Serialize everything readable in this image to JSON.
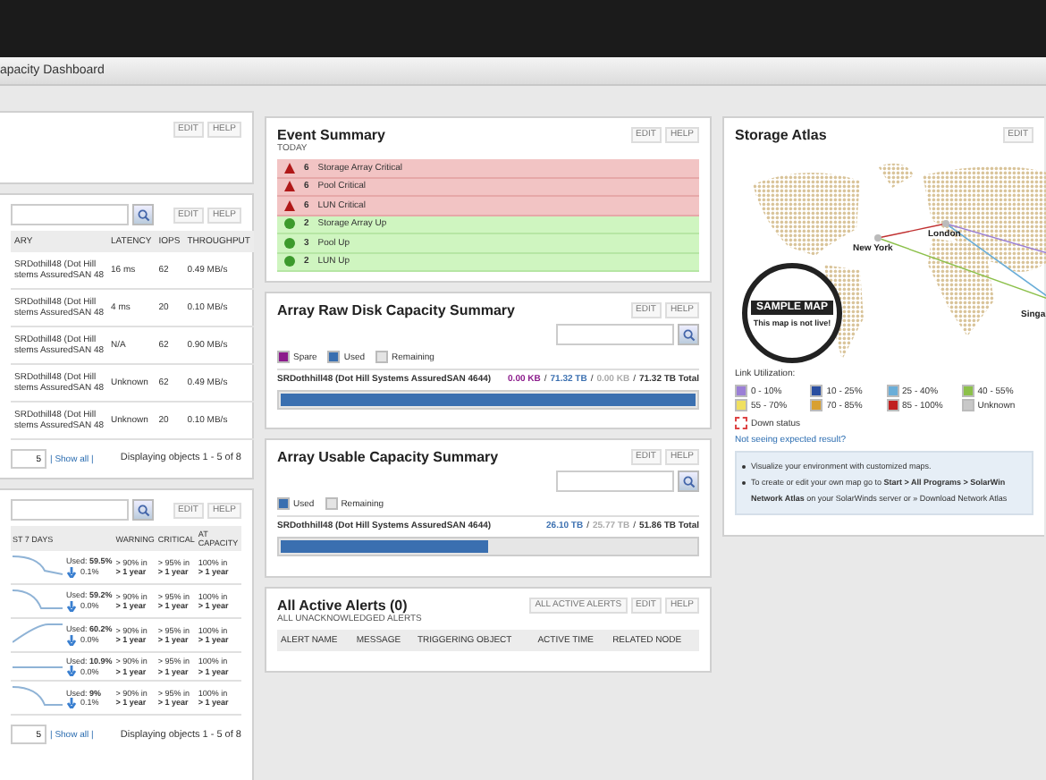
{
  "window": {
    "title": "apacity Dashboard"
  },
  "left_top_panel": {
    "buttons": [
      "EDIT",
      "HELP"
    ]
  },
  "performance_panel": {
    "buttons": [
      "EDIT",
      "HELP"
    ],
    "columns": [
      "ARY",
      "LATENCY",
      "IOPS",
      "THROUGHPUT"
    ],
    "rows": [
      {
        "name_lines": [
          "SRDothill48 (Dot Hill",
          "stems AssuredSAN 48"
        ],
        "latency": "16 ms",
        "iops": "62",
        "throughput": "0.49 MB/s"
      },
      {
        "name_lines": [
          "SRDothill48 (Dot Hill",
          "stems AssuredSAN 48"
        ],
        "latency": "4 ms",
        "iops": "20",
        "throughput": "0.10 MB/s"
      },
      {
        "name_lines": [
          "SRDothill48 (Dot Hill",
          "stems AssuredSAN 48"
        ],
        "latency": "N/A",
        "iops": "62",
        "throughput": "0.90 MB/s"
      },
      {
        "name_lines": [
          "SRDothill48 (Dot Hill",
          "stems AssuredSAN 48"
        ],
        "latency": "Unknown",
        "iops": "62",
        "throughput": "0.49 MB/s"
      },
      {
        "name_lines": [
          "SRDothill48 (Dot Hill",
          "stems AssuredSAN 48"
        ],
        "latency": "Unknown",
        "iops": "20",
        "throughput": "0.10 MB/s"
      }
    ],
    "page_size": "5",
    "show_all": "| Show all |",
    "paging": "Displaying objects 1 - 5 of 8"
  },
  "forecast_panel": {
    "buttons": [
      "EDIT",
      "HELP"
    ],
    "columns": [
      "ST 7 DAYS",
      "WARNING",
      "CRITICAL",
      "AT CAPACITY"
    ],
    "rows": [
      {
        "used_label": "Used:",
        "used": "59.5%",
        "change": "0.1%",
        "warning": [
          "> 90% in",
          "> 1 year"
        ],
        "critical": [
          "> 95% in",
          "> 1 year"
        ],
        "capacity": [
          "100% in",
          "> 1 year"
        ]
      },
      {
        "used_label": "Used:",
        "used": "59.2%",
        "change": "0.0%",
        "warning": [
          "> 90% in",
          "> 1 year"
        ],
        "critical": [
          "> 95% in",
          "> 1 year"
        ],
        "capacity": [
          "100% in",
          "> 1 year"
        ]
      },
      {
        "used_label": "Used:",
        "used": "60.2%",
        "change": "0.0%",
        "warning": [
          "> 90% in",
          "> 1 year"
        ],
        "critical": [
          "> 95% in",
          "> 1 year"
        ],
        "capacity": [
          "100% in",
          "> 1 year"
        ]
      },
      {
        "used_label": "Used:",
        "used": "10.9%",
        "change": "0.0%",
        "warning": [
          "> 90% in",
          "> 1 year"
        ],
        "critical": [
          "> 95% in",
          "> 1 year"
        ],
        "capacity": [
          "100% in",
          "> 1 year"
        ]
      },
      {
        "used_label": "Used:",
        "used": "9%",
        "change": "0.1%",
        "warning": [
          "> 90% in",
          "> 1 year"
        ],
        "critical": [
          "> 95% in",
          "> 1 year"
        ],
        "capacity": [
          "100% in",
          "> 1 year"
        ]
      }
    ],
    "page_size": "5",
    "show_all": "| Show all |",
    "paging": "Displaying objects 1 - 5 of 8"
  },
  "event_summary": {
    "title": "Event Summary",
    "subtitle": "TODAY",
    "buttons": [
      "EDIT",
      "HELP"
    ],
    "events": [
      {
        "kind": "critical",
        "count": "6",
        "label": "Storage Array Critical"
      },
      {
        "kind": "critical",
        "count": "6",
        "label": "Pool Critical"
      },
      {
        "kind": "critical",
        "count": "6",
        "label": "LUN Critical"
      },
      {
        "kind": "up",
        "count": "2",
        "label": "Storage Array Up"
      },
      {
        "kind": "up",
        "count": "3",
        "label": "Pool Up"
      },
      {
        "kind": "up",
        "count": "2",
        "label": "LUN Up"
      }
    ]
  },
  "raw_capacity": {
    "title": "Array Raw Disk Capacity Summary",
    "buttons": [
      "EDIT",
      "HELP"
    ],
    "legend": [
      {
        "label": "Spare",
        "color": "#8b1a8b"
      },
      {
        "label": "Used",
        "color": "#3a6fb0"
      },
      {
        "label": "Remaining",
        "color": "#e4e4e4"
      }
    ],
    "array": "SRDothhill48 (Dot Hill Systems AssuredSAN 4644)",
    "figures": [
      {
        "text": "0.00 KB",
        "color": "#8b1a8b"
      },
      {
        "text": "71.32 TB",
        "color": "#3a6fb0"
      },
      {
        "text": "0.00 KB",
        "color": "#aaaaaa"
      }
    ],
    "separator": "/",
    "total": "71.32 TB Total",
    "level": 1
  },
  "usable_capacity": {
    "title": "Array Usable Capacity Summary",
    "buttons": [
      "EDIT",
      "HELP"
    ],
    "legend": [
      {
        "label": "Used",
        "color": "#3a6fb0"
      },
      {
        "label": "Remaining",
        "color": "#e4e4e4"
      }
    ],
    "array": "SRDothhill48 (Dot Hill Systems AssuredSAN 4644)",
    "figures": [
      {
        "text": "26.10 TB",
        "color": "#3a6fb0"
      },
      {
        "text": "25.77 TB",
        "color": "#aaaaaa"
      }
    ],
    "separator": "/",
    "total": "51.86 TB Total",
    "level": 0.5
  },
  "active_alerts": {
    "title": "All Active Alerts (0)",
    "subtitle": "ALL UNACKNOWLEDGED ALERTS",
    "buttons": [
      "ALL ACTIVE ALERTS",
      "EDIT",
      "HELP"
    ],
    "columns": [
      "ALERT NAME",
      "MESSAGE",
      "TRIGGERING OBJECT",
      "ACTIVE TIME",
      "RELATED NODE"
    ]
  },
  "storage_atlas": {
    "title": "Storage Atlas",
    "buttons": [
      "EDIT"
    ],
    "cities": [
      "New York",
      "London",
      "Singa"
    ],
    "stamp": {
      "top": "SAMPLE MAP",
      "bottom": "This map is not live!"
    },
    "legend_title": "Link Utilization:",
    "legend": [
      {
        "label": "0 - 10%",
        "color": "#9b7fd6"
      },
      {
        "label": "10 - 25%",
        "color": "#2a4ea0"
      },
      {
        "label": "25 - 40%",
        "color": "#6aaed8"
      },
      {
        "label": "40 - 55%",
        "color": "#8cc04a"
      },
      {
        "label": "55 - 70%",
        "color": "#f0e060"
      },
      {
        "label": "70 - 85%",
        "color": "#d8a030"
      },
      {
        "label": "85 - 100%",
        "color": "#c02020"
      },
      {
        "label": "Unknown",
        "color": "#c8c8c8"
      }
    ],
    "down_status": "Down status",
    "help_link": "Not seeing expected result?",
    "tips": [
      "Visualize your environment with customized maps.",
      "To create or edit your own map go to **Start > All Programs > SolarWin**"
    ],
    "tip_continuation": "**Network Atlas** on your SolarWinds server or » Download Network Atlas"
  }
}
